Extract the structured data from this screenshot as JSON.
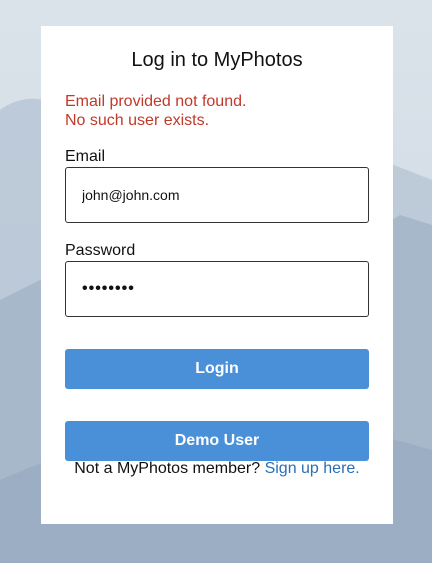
{
  "login": {
    "title": "Log in to MyPhotos",
    "errors": [
      "Email provided not found.",
      "No such user exists."
    ],
    "email_label": "Email",
    "email_value": "john@john.com",
    "password_label": "Password",
    "password_value": "••••••••",
    "login_button": "Login",
    "demo_button": "Demo User",
    "footer_text": "Not a MyPhotos member?",
    "signup_link": "Sign up here."
  },
  "colors": {
    "error": "#c0392b",
    "button": "#4a90d9",
    "link": "#2a6fb5"
  }
}
